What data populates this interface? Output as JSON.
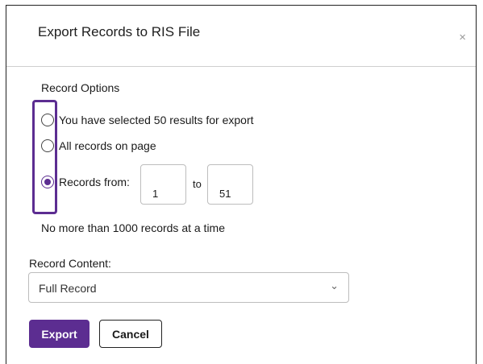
{
  "dialog": {
    "title": "Export Records to RIS File",
    "close_icon": "×"
  },
  "record_options": {
    "label": "Record Options",
    "options": [
      {
        "label": "You have selected 50 results for export",
        "checked": false
      },
      {
        "label": "All records on page",
        "checked": false
      },
      {
        "label": "Records from:",
        "checked": true
      }
    ],
    "range_from": "1",
    "range_to_label": "to",
    "range_to": "51",
    "limit_note": "No more than 1000 records at a time"
  },
  "record_content": {
    "label": "Record Content:",
    "selected": "Full Record",
    "chevron": "⌄"
  },
  "buttons": {
    "export": "Export",
    "cancel": "Cancel"
  },
  "colors": {
    "accent": "#5c2d91",
    "highlight_border": "#5c2d91"
  }
}
